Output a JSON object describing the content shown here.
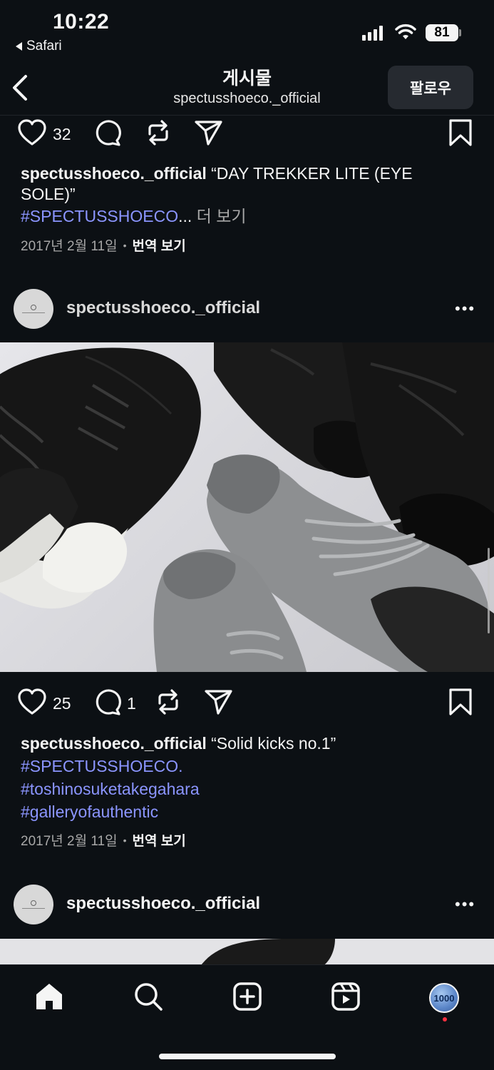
{
  "status": {
    "time": "10:22",
    "back_app": "Safari",
    "battery": "81"
  },
  "header": {
    "title": "게시물",
    "subtitle": "spectusshoeco._official",
    "follow_label": "팔로우"
  },
  "post1": {
    "likes": "32",
    "username": "spectusshoeco._official",
    "caption": "“DAY TREKKER LITE (EYE SOLE)”",
    "hashtag": "#SPECTUSSHOECO",
    "ellipsis": "...",
    "more_label": "더 보기",
    "date": "2017년 2월 11일",
    "translate_label": "번역 보기"
  },
  "post2": {
    "username": "spectusshoeco._official",
    "likes": "25",
    "comments": "1",
    "caption_user": "spectusshoeco._official",
    "caption": "“Solid kicks no.1”",
    "hashtags": [
      "#SPECTUSSHOECO.",
      "#toshinosuketakegahara",
      "#galleryofauthentic"
    ],
    "date": "2017년 2월 11일",
    "translate_label": "번역 보기"
  },
  "post3": {
    "username": "spectusshoeco._official"
  },
  "icons": {
    "like": "heart-icon",
    "comment": "comment-icon",
    "repost": "repost-icon",
    "share": "send-icon",
    "save": "bookmark-icon",
    "more": "more-icon"
  },
  "nav": {
    "profile_avatar_text": "1000"
  },
  "colors": {
    "background": "#0c1014",
    "hashtag": "#8b95ff",
    "button_bg": "#262a30",
    "notification": "#ff3040"
  }
}
